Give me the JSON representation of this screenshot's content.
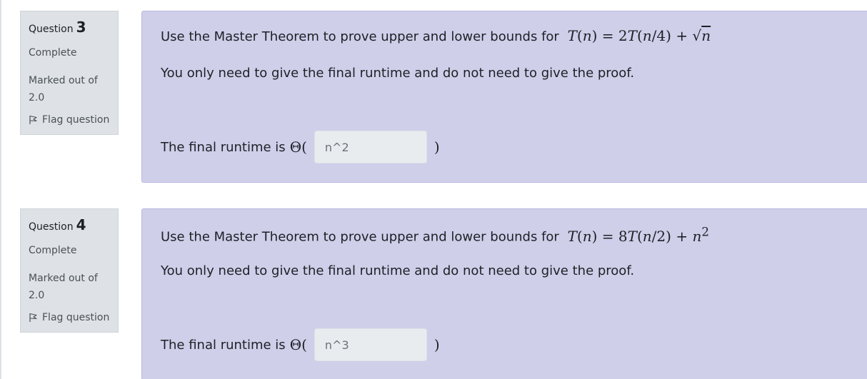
{
  "questions": [
    {
      "label": "Question",
      "number": "3",
      "state": "Complete",
      "grade_line1": "Marked out of",
      "grade_line2": "2.0",
      "flag_label": "Flag question",
      "prompt_text": "Use the Master Theorem to prove upper and lower bounds for",
      "formula_lhs": "T",
      "formula_rhs_a": "2",
      "formula_rhs_b": "4",
      "formula_term": "n",
      "note": "You only need to give the final runtime and do not need to give the proof.",
      "answer_label": "The final runtime is",
      "answer_value": "n^2"
    },
    {
      "label": "Question",
      "number": "4",
      "state": "Complete",
      "grade_line1": "Marked out of",
      "grade_line2": "2.0",
      "flag_label": "Flag question",
      "prompt_text": "Use the Master Theorem to prove upper and lower bounds for",
      "formula_lhs": "T",
      "formula_rhs_a": "8",
      "formula_rhs_b": "2",
      "formula_term": "n",
      "note": "You only need to give the final runtime and do not need to give the proof.",
      "answer_label": "The final runtime is",
      "answer_value": "n^3"
    }
  ],
  "colors": {
    "content_bg": "#cfcfea",
    "info_bg": "#dee2e6",
    "input_bg": "#e9ecef"
  },
  "icons": {
    "flag": "flag-icon"
  }
}
